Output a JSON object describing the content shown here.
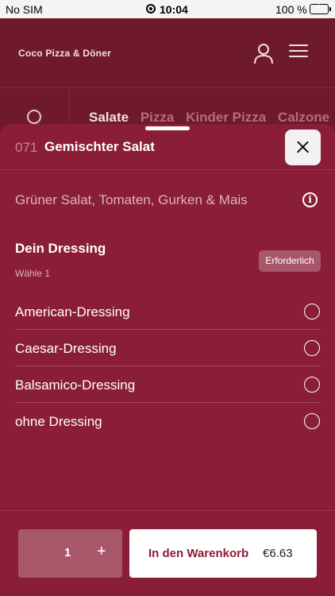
{
  "status_bar": {
    "carrier": "No SIM",
    "time": "10:04",
    "battery": "100 %"
  },
  "header": {
    "title": "Coco Pizza & Döner"
  },
  "categories": [
    "Salate",
    "Pizza",
    "Kinder Pizza",
    "Calzone"
  ],
  "item": {
    "number": "071",
    "name": "Gemischter Salat",
    "description": "Grüner Salat, Tomaten, Gurken & Mais"
  },
  "option_group": {
    "title": "Dein Dressing",
    "subtitle": "Wähle 1",
    "badge": "Erforderlich",
    "options": [
      "American-Dressing",
      "Caesar-Dressing",
      "Balsamico-Dressing",
      "ohne Dressing"
    ]
  },
  "footer": {
    "quantity": "1",
    "plus_label": "+",
    "cart_label": "In den Warenkorb",
    "price": "€6.63"
  },
  "colors": {
    "accent": "#8a1e36",
    "header_bg": "#6e1a2c",
    "badge_bg": "#a8566a"
  }
}
